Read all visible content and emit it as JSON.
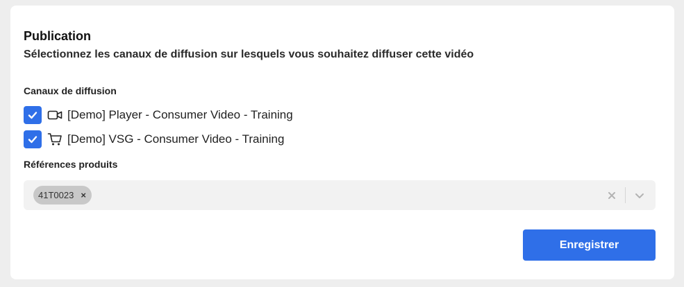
{
  "publication": {
    "title": "Publication",
    "subtitle": "Sélectionnez les canaux de diffusion sur lesquels vous souhaitez diffuser cette vidéo"
  },
  "channels": {
    "label": "Canaux de diffusion",
    "items": [
      {
        "label": "[Demo] Player - Consumer Video - Training",
        "icon": "video-camera-icon",
        "checked": true
      },
      {
        "label": "[Demo] VSG - Consumer Video - Training",
        "icon": "shopping-cart-icon",
        "checked": true
      }
    ]
  },
  "product_refs": {
    "label": "Références produits",
    "tags": [
      {
        "label": "41T0023",
        "remove": "×"
      }
    ]
  },
  "actions": {
    "save_label": "Enregistrer"
  },
  "colors": {
    "accent": "#2f6fe8",
    "tag_bg": "#c8c8c8",
    "field_bg": "#f2f2f2"
  }
}
